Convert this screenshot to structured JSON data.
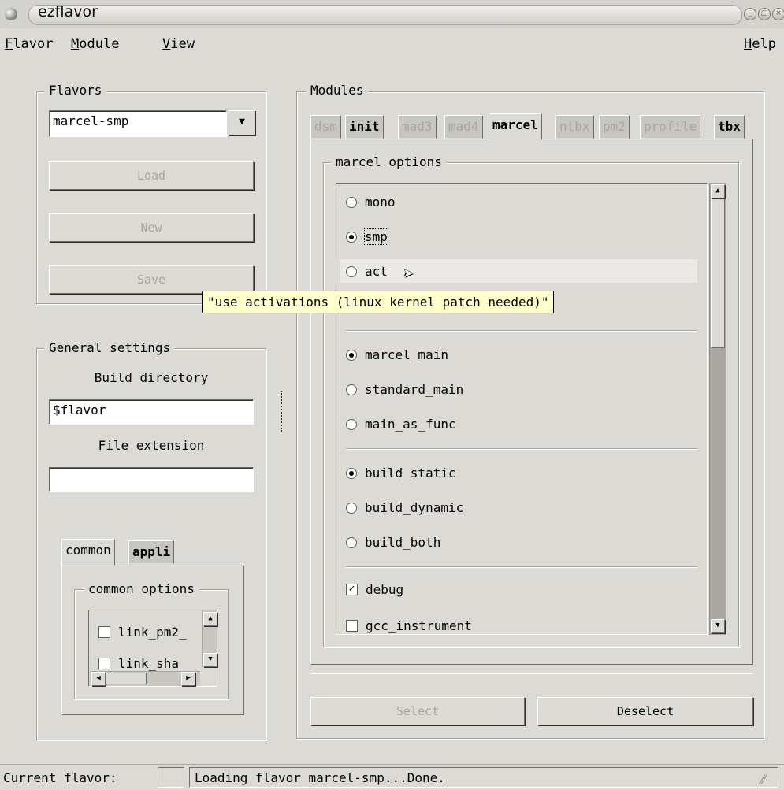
{
  "window": {
    "title": "ezflavor"
  },
  "menu": {
    "flavor": {
      "mnemonic": "F",
      "rest": "lavor"
    },
    "module": {
      "mnemonic": "M",
      "rest": "odule"
    },
    "view": {
      "mnemonic": "V",
      "rest": "iew"
    },
    "help": {
      "mnemonic": "H",
      "rest": "elp"
    }
  },
  "flavors": {
    "label": "Flavors",
    "selected": "marcel-smp",
    "load_button": "Load",
    "new_button": "New",
    "save_button": "Save"
  },
  "general": {
    "label": "General settings",
    "build_dir_label": "Build directory",
    "build_dir_value": "$flavor",
    "file_ext_label": "File extension",
    "file_ext_value": "",
    "tabs": [
      "common",
      "appli"
    ],
    "options_label": "common options",
    "options": [
      {
        "label": "link_pm2_",
        "checked": false
      },
      {
        "label": "link_sha",
        "checked": false
      }
    ]
  },
  "modules": {
    "label": "Modules",
    "tabs": [
      {
        "label": "dsm",
        "enabled": false
      },
      {
        "label": "init",
        "enabled": true
      },
      {
        "label": "mad3",
        "enabled": false
      },
      {
        "label": "mad4",
        "enabled": false
      },
      {
        "label": "marcel",
        "enabled": true,
        "active": true
      },
      {
        "label": "ntbx",
        "enabled": false
      },
      {
        "label": "pm2",
        "enabled": false
      },
      {
        "label": "profile",
        "enabled": false
      },
      {
        "label": "tbx",
        "enabled": true
      }
    ],
    "options_label": "marcel options",
    "option_groups": [
      [
        {
          "label": "mono",
          "type": "radio",
          "checked": false
        },
        {
          "label": "smp",
          "type": "radio",
          "checked": true
        },
        {
          "label": "act",
          "type": "radio",
          "checked": false
        }
      ],
      [
        {
          "label": "marcel_main",
          "type": "radio",
          "checked": true
        },
        {
          "label": "standard_main",
          "type": "radio",
          "checked": false
        },
        {
          "label": "main_as_func",
          "type": "radio",
          "checked": false
        }
      ],
      [
        {
          "label": "build_static",
          "type": "radio",
          "checked": true
        },
        {
          "label": "build_dynamic",
          "type": "radio",
          "checked": false
        },
        {
          "label": "build_both",
          "type": "radio",
          "checked": false
        }
      ],
      [
        {
          "label": "debug",
          "type": "check",
          "checked": true
        },
        {
          "label": "gcc_instrument",
          "type": "check",
          "checked": false
        }
      ]
    ],
    "tooltip": "\"use activations (linux kernel patch needed)\"",
    "select_button": "Select",
    "deselect_button": "Deselect"
  },
  "status": {
    "label": "Current flavor:",
    "message": "Loading flavor marcel-smp...Done."
  }
}
